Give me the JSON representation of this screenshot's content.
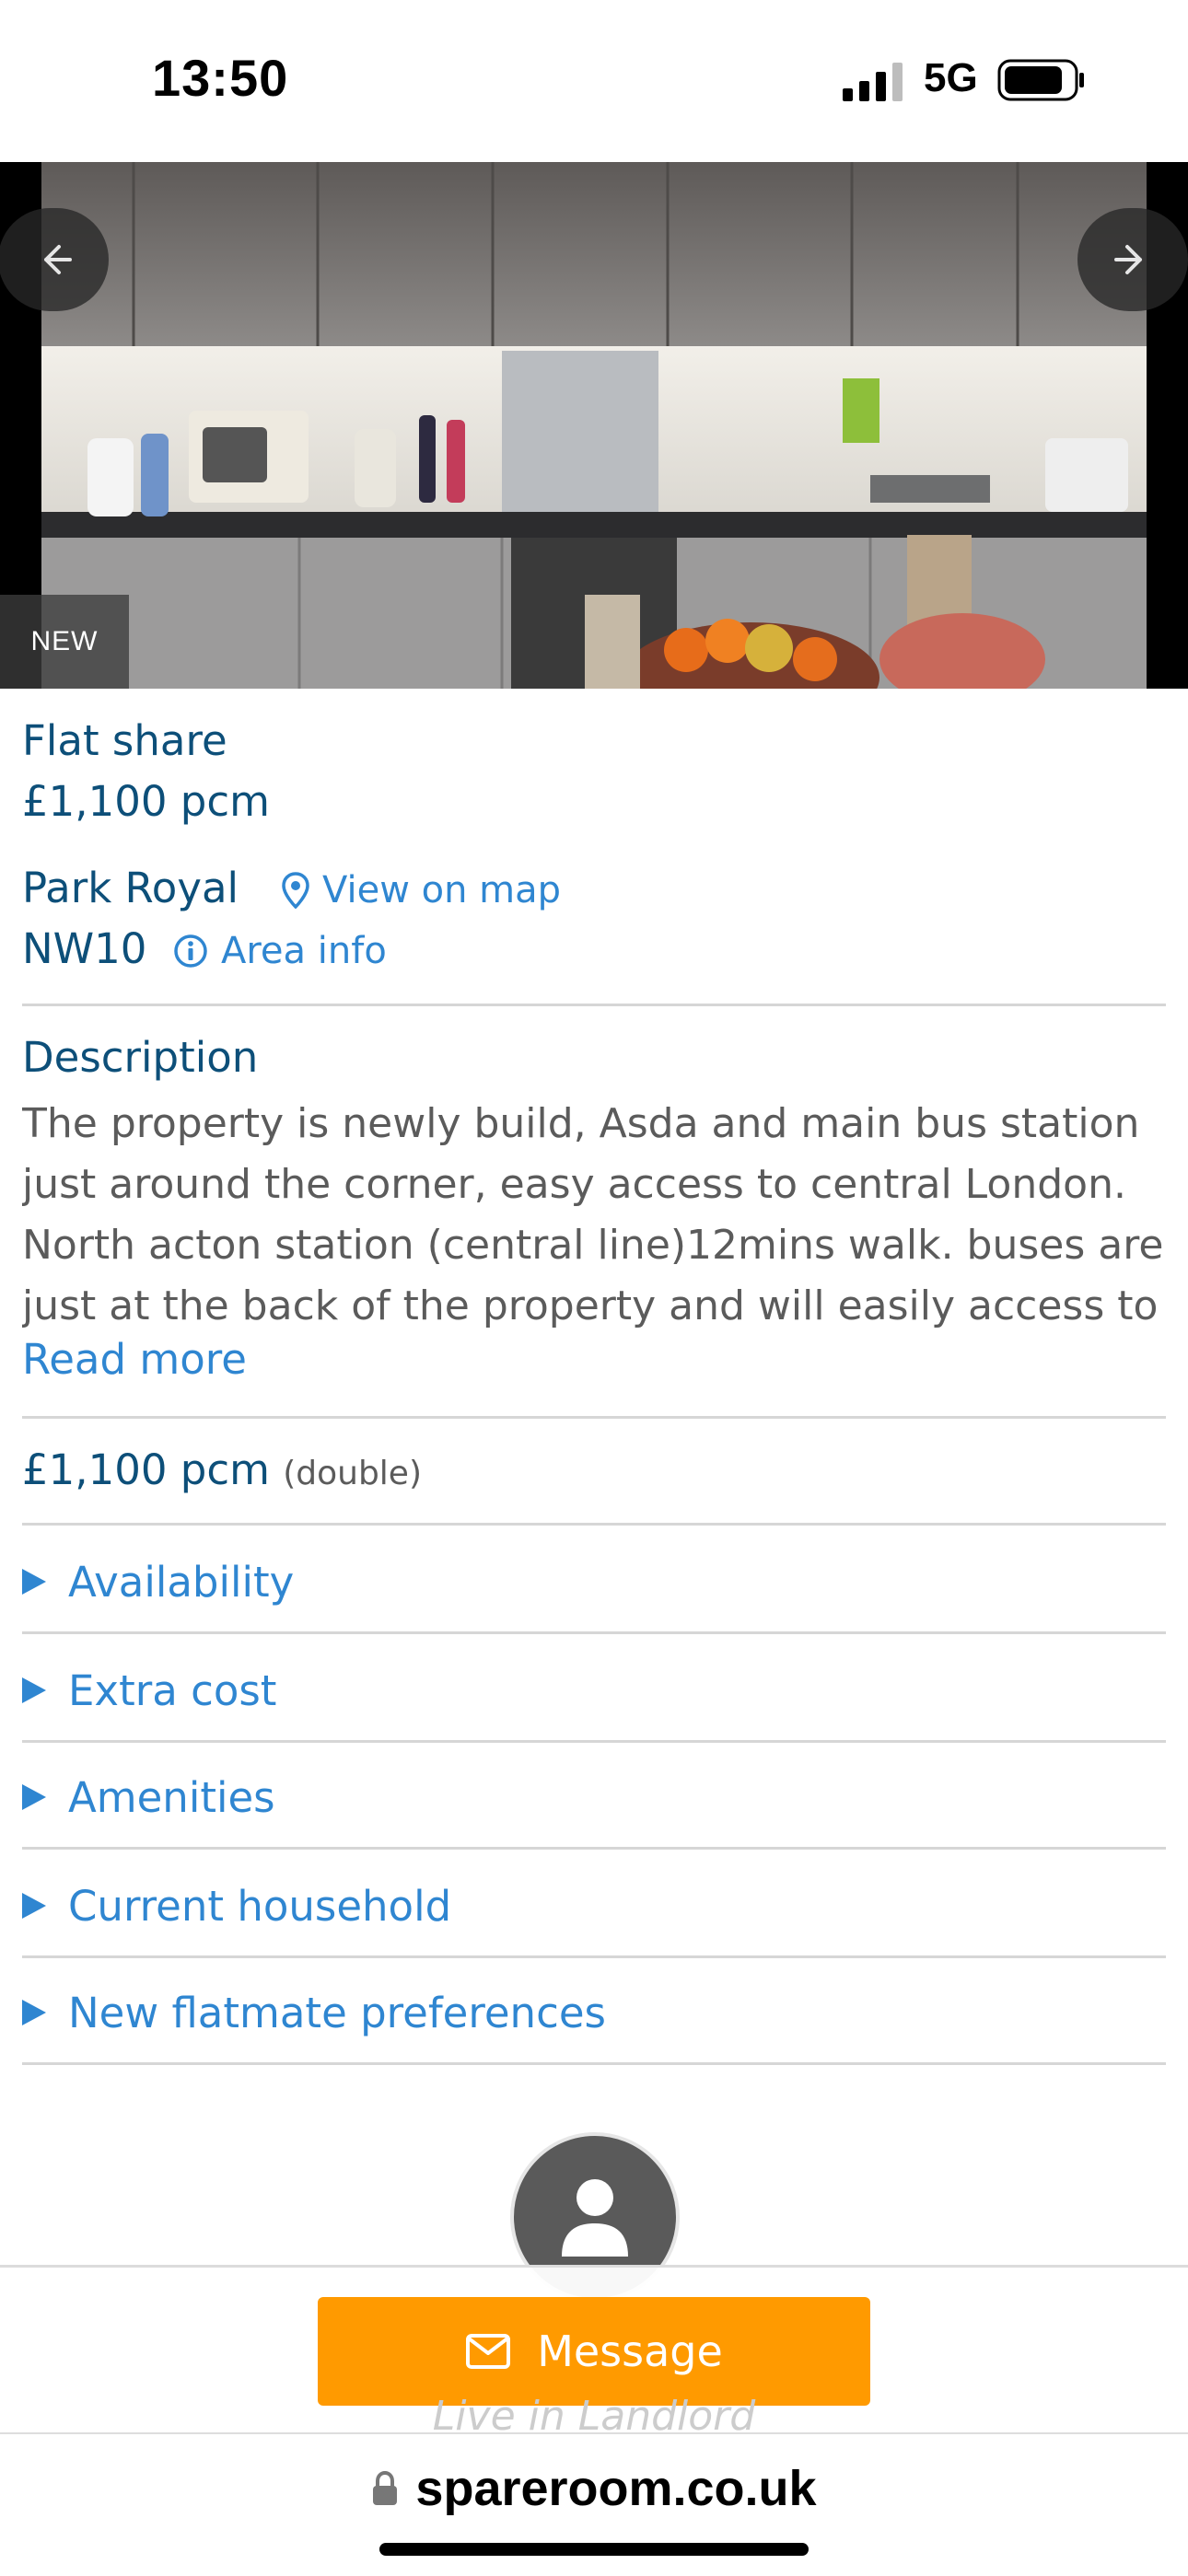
{
  "status": {
    "time": "13:50",
    "network": "5G"
  },
  "gallery": {
    "badge": "NEW"
  },
  "listing": {
    "type": "Flat share",
    "price": "£1,100 pcm",
    "area": "Park Royal",
    "postcode": "NW10",
    "view_on_map": "View on map",
    "area_info": "Area info"
  },
  "description": {
    "title": "Description",
    "text": "The property is newly build, Asda and main bus station just around the corner, easy access to central London. North acton station (central line)12mins walk. buses are just at the back of the property and will easily access to",
    "read_more": "Read more"
  },
  "room": {
    "price": "£1,100 pcm",
    "type": "(double)"
  },
  "sections": [
    "Availability",
    "Extra cost",
    "Amenities",
    "Current household",
    "New flatmate preferences"
  ],
  "contact": {
    "message_label": "Message",
    "role": "Live in Landlord"
  },
  "browser": {
    "url": "spareroom.co.uk"
  },
  "colors": {
    "brand_blue": "#0d4f79",
    "link_blue": "#2f86d1",
    "accent_orange": "#ff9a00"
  }
}
